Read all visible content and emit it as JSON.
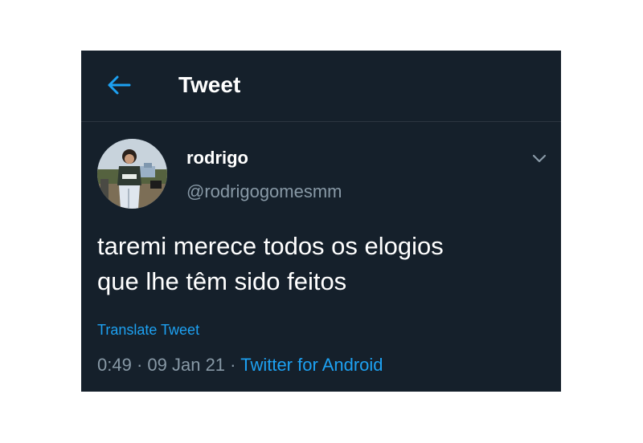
{
  "colors": {
    "background": "#15202b",
    "accent": "#1da1f2",
    "text_primary": "#ffffff",
    "text_secondary": "#8899a6",
    "divider": "#2c3640"
  },
  "header": {
    "back_icon": "arrow-left-icon",
    "title": "Tweet"
  },
  "author": {
    "display_name": "rodrigo",
    "handle": "@rodrigogomesmm",
    "avatar_icon": "profile-photo",
    "menu_icon": "chevron-down-icon"
  },
  "tweet": {
    "text_lines": [
      "taremi merece todos os elogios",
      "que lhe têm sido feitos"
    ],
    "translate_label": "Translate Tweet",
    "time": "0:49",
    "separator": "·",
    "date": "09 Jan 21",
    "source": "Twitter for Android"
  }
}
